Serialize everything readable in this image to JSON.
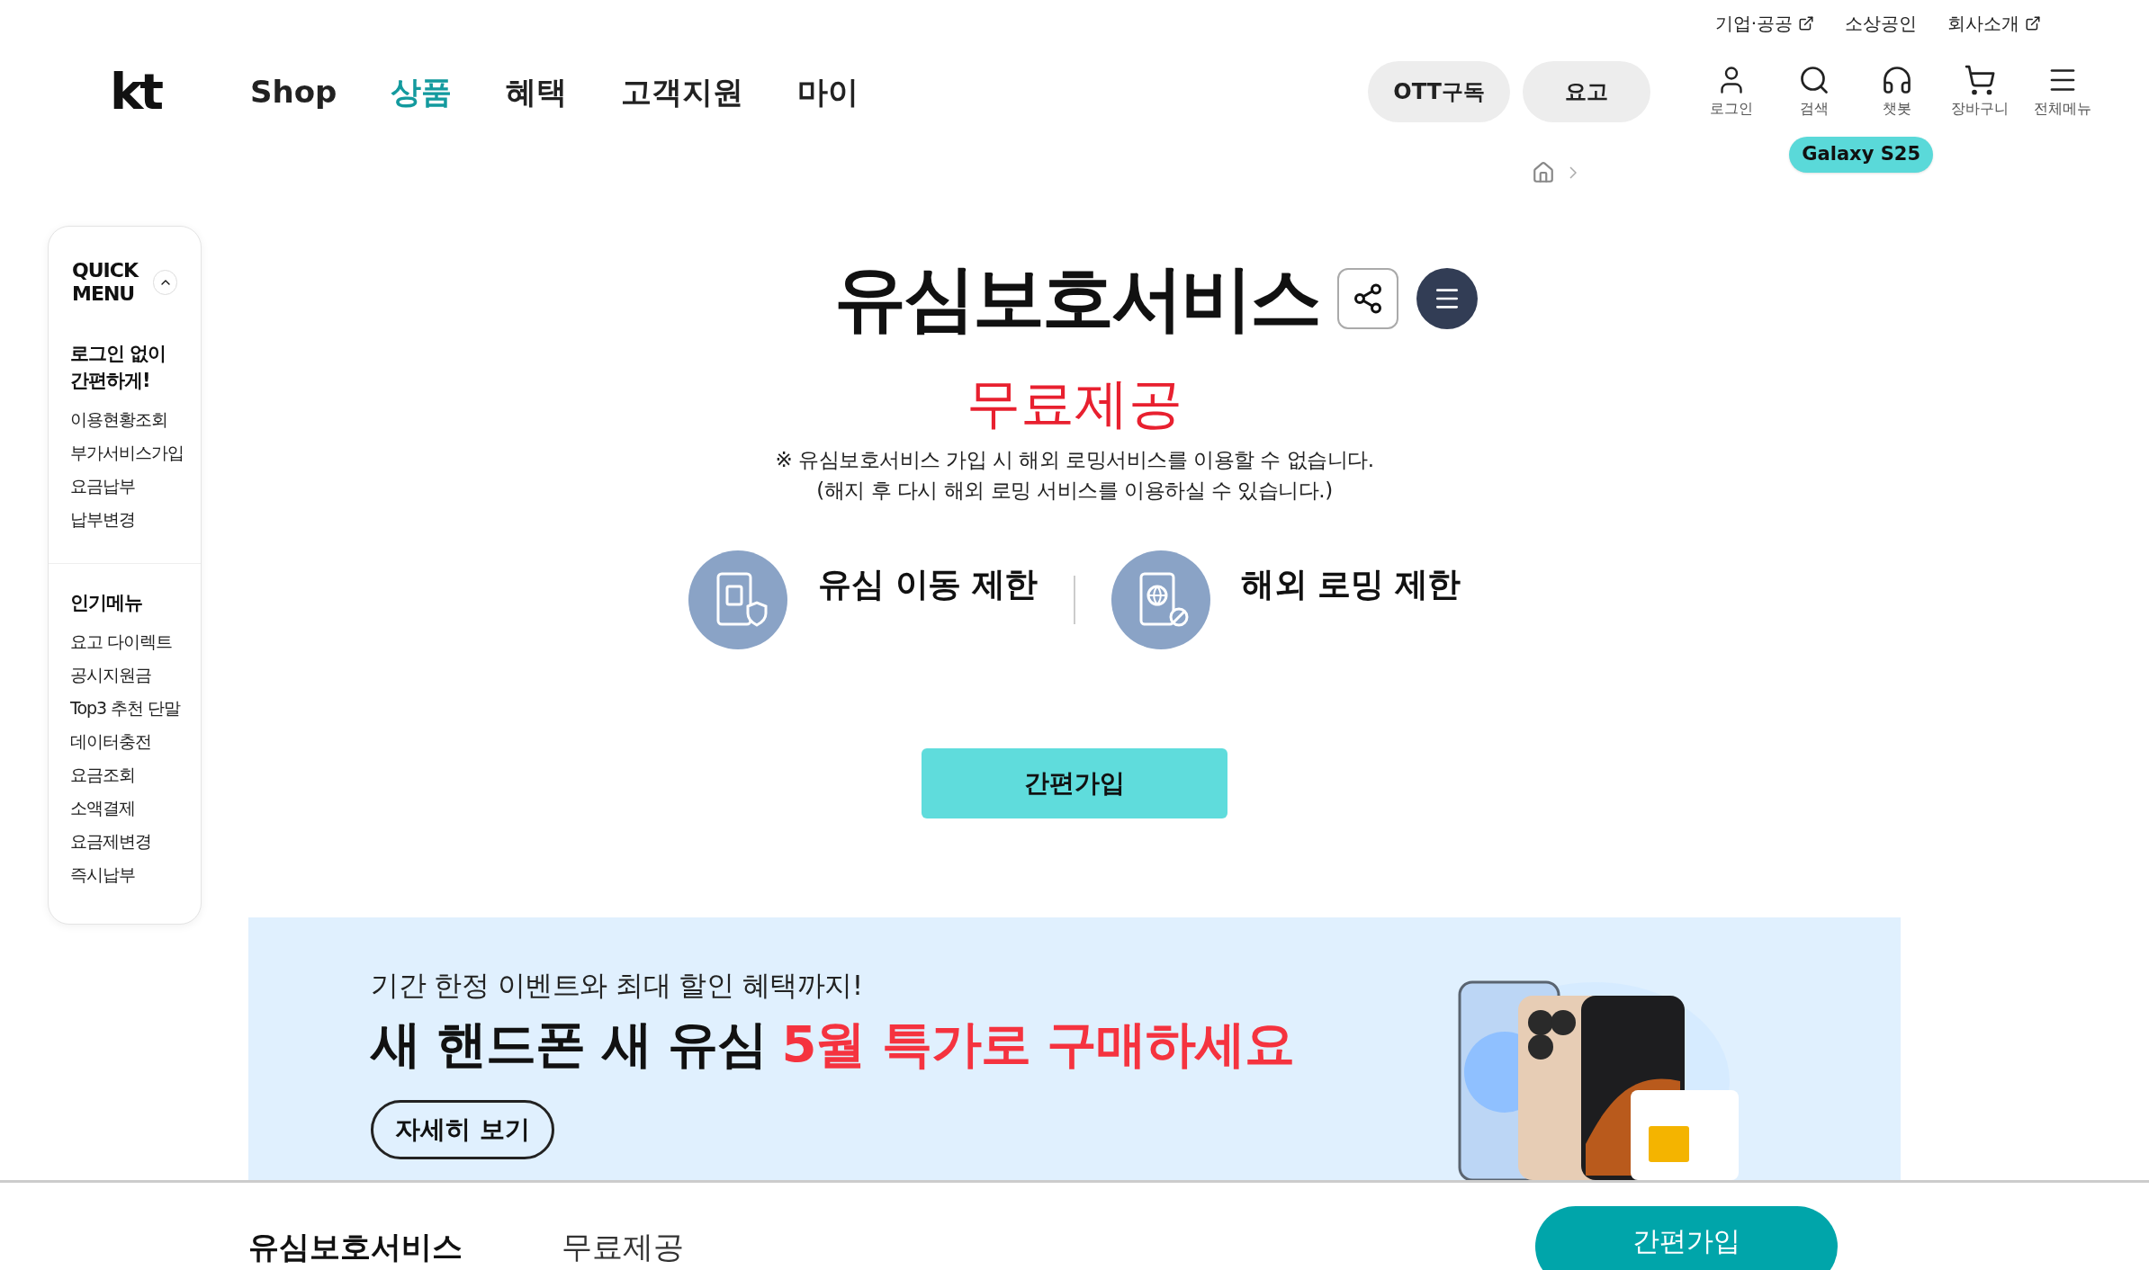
{
  "utility_links": [
    {
      "label": "기업·공공",
      "external": true
    },
    {
      "label": "소상공인",
      "external": false
    },
    {
      "label": "회사소개",
      "external": true
    }
  ],
  "logo": "kt",
  "nav": [
    {
      "label": "Shop",
      "selected": false
    },
    {
      "label": "상품",
      "selected": true
    },
    {
      "label": "혜택",
      "selected": false
    },
    {
      "label": "고객지원",
      "selected": false
    },
    {
      "label": "마이",
      "selected": false
    }
  ],
  "header_buttons": [
    "OTT구독",
    "요고"
  ],
  "header_icons": [
    {
      "label": "로그인",
      "kind": "user"
    },
    {
      "label": "검색",
      "kind": "search"
    },
    {
      "label": "챗봇",
      "kind": "chatbot"
    },
    {
      "label": "장바구니",
      "kind": "cart"
    },
    {
      "label": "전체메뉴",
      "kind": "menu"
    }
  ],
  "tooltip": "Galaxy S25",
  "quick_menu": {
    "title": "QUICK MENU",
    "expanded": true,
    "sections": [
      {
        "heading": "로그인 없이 간편하게!",
        "items": [
          "이용현황조회",
          "부가서비스가입",
          "요금납부",
          "납부변경"
        ]
      },
      {
        "heading": "인기메뉴",
        "items": [
          "요고 다이렉트",
          "공시지원금",
          "Top3 추천 단말",
          "데이터충전",
          "요금조회",
          "소액결제",
          "요금제변경",
          "즉시납부"
        ]
      }
    ]
  },
  "product": {
    "title": "유심보호서비스",
    "price": "무료제공",
    "notes": [
      "※ 유심보호서비스 가입 시 해외 로밍서비스를 이용할 수 없습니다.",
      "(해지 후 다시 해외 로밍 서비스를 이용하실 수 있습니다.)"
    ],
    "features": [
      {
        "label": "유심 이동 제한",
        "kind": "sim"
      },
      {
        "label": "해외 로밍 제한",
        "kind": "roaming"
      }
    ],
    "join_button": "간편가입"
  },
  "banner": {
    "kicker": "기간 한정 이벤트와 최대 할인 혜택까지!",
    "headline": "새 핸드폰 새 유심",
    "highlight": "5월 특가로 구매하세요",
    "button": "자세히 보기"
  },
  "sticky_bar": {
    "name": "유심보호서비스",
    "price": "무료제공",
    "button": "간편가입"
  }
}
